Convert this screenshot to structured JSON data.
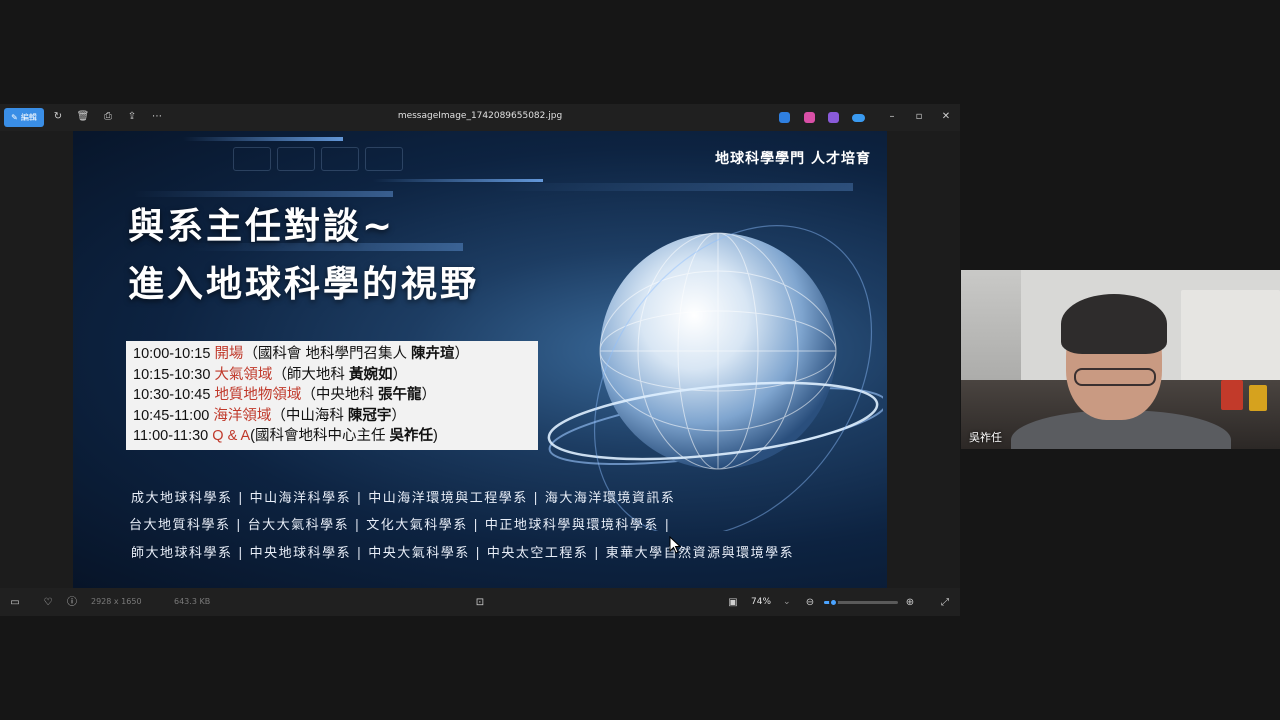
{
  "viewer": {
    "edit_label": "編輯",
    "filename": "messageImage_1742089655082.jpg",
    "toolbar_icons": [
      "rotate-icon",
      "delete-icon",
      "print-icon",
      "share-icon",
      "more-icon"
    ],
    "window_controls": [
      "minimize-icon",
      "maximize-icon",
      "close-icon"
    ],
    "status": {
      "dimensions": "2928 x 1650",
      "filesize": "643.3 KB",
      "zoom": "74%",
      "zoom_level": 0.12
    }
  },
  "slide": {
    "header": "地球科學學門 人才培育",
    "title_line1": "與系主任對談~",
    "title_line2": "進入地球科學的視野",
    "schedule": [
      {
        "time": "10:00-10:15",
        "topic": "開場",
        "detail_pre": "（國科會 地科學門召集人 ",
        "speaker": "陳卉瑄",
        "detail_post": "）"
      },
      {
        "time": "10:15-10:30",
        "topic": "大氣領域",
        "detail_pre": "（師大地科 ",
        "speaker": "黃婉如",
        "detail_post": "）"
      },
      {
        "time": "10:30-10:45",
        "topic": "地質地物領域",
        "detail_pre": "（中央地科 ",
        "speaker": "張午龍",
        "detail_post": "）"
      },
      {
        "time": "10:45-11:00",
        "topic": "海洋領域",
        "detail_pre": "（中山海科 ",
        "speaker": "陳冠宇",
        "detail_post": "）"
      },
      {
        "time": "11:00-11:30",
        "topic": "Q & A",
        "detail_pre": "(國科會地科中心主任 ",
        "speaker": "吳祚任",
        "detail_post": ")"
      }
    ],
    "departments": [
      "成大地球科學系 | 中山海洋科學系 | 中山海洋環境與工程學系 | 海大海洋環境資訊系",
      "台大地質科學系 | 台大大氣科學系 | 文化大氣科學系 | 中正地球科學與環境科學系 |",
      "師大地球科學系 | 中央地球科學系 | 中央大氣科學系 | 中央太空工程系 | 東華大學自然資源與環境學系"
    ]
  },
  "video": {
    "participant_name": "吳祚任"
  }
}
